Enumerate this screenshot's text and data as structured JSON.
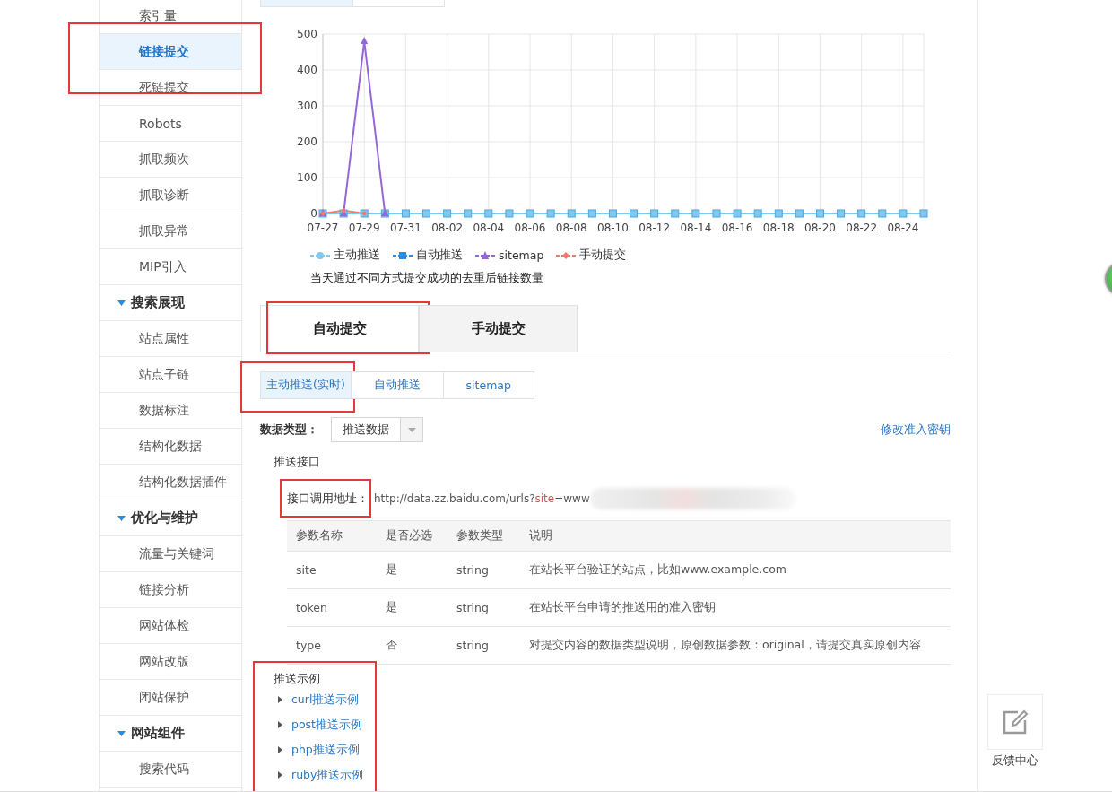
{
  "sidebar": {
    "items": [
      {
        "kind": "item",
        "label": "索引量",
        "selected": false,
        "highlighted": false
      },
      {
        "kind": "item",
        "label": "链接提交",
        "selected": true,
        "highlighted": true
      },
      {
        "kind": "item",
        "label": "死链提交",
        "selected": false,
        "highlighted": false
      },
      {
        "kind": "item",
        "label": "Robots",
        "selected": false,
        "highlighted": false
      },
      {
        "kind": "item",
        "label": "抓取频次",
        "selected": false,
        "highlighted": false
      },
      {
        "kind": "item",
        "label": "抓取诊断",
        "selected": false,
        "highlighted": false
      },
      {
        "kind": "item",
        "label": "抓取异常",
        "selected": false,
        "highlighted": false
      },
      {
        "kind": "item",
        "label": "MIP引入",
        "selected": false,
        "highlighted": false
      },
      {
        "kind": "section",
        "label": "搜索展现",
        "expanded": true
      },
      {
        "kind": "item",
        "label": "站点属性",
        "selected": false,
        "highlighted": false
      },
      {
        "kind": "item",
        "label": "站点子链",
        "selected": false,
        "highlighted": false
      },
      {
        "kind": "item",
        "label": "数据标注",
        "selected": false,
        "highlighted": false
      },
      {
        "kind": "item",
        "label": "结构化数据",
        "selected": false,
        "highlighted": false
      },
      {
        "kind": "item",
        "label": "结构化数据插件",
        "selected": false,
        "highlighted": false
      },
      {
        "kind": "section",
        "label": "优化与维护",
        "expanded": true
      },
      {
        "kind": "item",
        "label": "流量与关键词",
        "selected": false,
        "highlighted": false
      },
      {
        "kind": "item",
        "label": "链接分析",
        "selected": false,
        "highlighted": false
      },
      {
        "kind": "item",
        "label": "网站体检",
        "selected": false,
        "highlighted": false
      },
      {
        "kind": "item",
        "label": "网站改版",
        "selected": false,
        "highlighted": false
      },
      {
        "kind": "item",
        "label": "闭站保护",
        "selected": false,
        "highlighted": false
      },
      {
        "kind": "section",
        "label": "网站组件",
        "expanded": true
      },
      {
        "kind": "item",
        "label": "搜索代码",
        "selected": false,
        "highlighted": false
      }
    ]
  },
  "chart": {
    "chart_data": {
      "type": "line",
      "categories": [
        "07-27",
        null,
        "07-29",
        null,
        "07-31",
        null,
        "08-02",
        null,
        "08-04",
        null,
        "08-06",
        null,
        "08-08",
        null,
        "08-10",
        null,
        "08-12",
        null,
        "08-14",
        null,
        "08-16",
        null,
        "08-18",
        null,
        "08-20",
        null,
        "08-22",
        null,
        "08-24",
        null
      ],
      "yticks": [
        0,
        100,
        200,
        300,
        400,
        500
      ],
      "ylim": [
        0,
        500
      ],
      "grid": true,
      "series": [
        {
          "name": "主动推送",
          "color": "#7fc8ee",
          "marker": "square",
          "values": [
            0,
            0,
            0,
            0,
            0,
            0,
            0,
            0,
            0,
            0,
            0,
            0,
            0,
            0,
            0,
            0,
            0,
            0,
            0,
            0,
            0,
            0,
            0,
            0,
            0,
            0,
            0,
            0,
            0,
            0
          ]
        },
        {
          "name": "自动推送",
          "color": "#2f8be0",
          "values": [
            null,
            null,
            null,
            null,
            null,
            null,
            null,
            null,
            null,
            null,
            null,
            null,
            null,
            null,
            null,
            null,
            null,
            null,
            null,
            null,
            null,
            null,
            null,
            null,
            null,
            null,
            null,
            null,
            null,
            null
          ]
        },
        {
          "name": "sitemap",
          "color": "#9466d8",
          "marker": "triangle",
          "values": [
            0,
            0,
            480,
            0,
            null,
            null,
            null,
            null,
            null,
            null,
            null,
            null,
            null,
            null,
            null,
            null,
            null,
            null,
            null,
            null,
            null,
            null,
            null,
            null,
            null,
            null,
            null,
            null,
            null,
            null
          ]
        },
        {
          "name": "手动提交",
          "color": "#f07a6a",
          "marker": "diamond",
          "values": [
            0,
            8,
            0,
            null,
            null,
            null,
            null,
            null,
            null,
            null,
            null,
            null,
            null,
            null,
            null,
            null,
            null,
            null,
            null,
            null,
            null,
            null,
            null,
            null,
            null,
            null,
            null,
            null,
            null,
            null
          ]
        }
      ]
    },
    "caption": "当天通过不同方式提交成功的去重后链接数量"
  },
  "tabs": [
    {
      "label": "自动提交",
      "selected": true,
      "highlighted": true
    },
    {
      "label": "手动提交",
      "selected": false,
      "highlighted": false
    }
  ],
  "subtabs": [
    {
      "label": "主动推送(实时)",
      "selected": true,
      "highlighted": true
    },
    {
      "label": "自动推送",
      "selected": false,
      "highlighted": false
    },
    {
      "label": "sitemap",
      "selected": false,
      "highlighted": false
    }
  ],
  "data_type": {
    "label": "数据类型：",
    "value": "推送数据"
  },
  "change_key_link": "修改准入密钥",
  "interface": {
    "title": "推送接口",
    "address_label": "接口调用地址：",
    "address_highlighted": true,
    "url_prefix": "http://data.zz.baidu.com/urls?",
    "url_param": "site",
    "url_suffix": "=www"
  },
  "table": {
    "columns": [
      "参数名称",
      "是否必选",
      "参数类型",
      "说明"
    ],
    "rows": [
      [
        "site",
        "是",
        "string",
        "在站长平台验证的站点，比如www.example.com"
      ],
      [
        "token",
        "是",
        "string",
        "在站长平台申请的推送用的准入密钥"
      ],
      [
        "type",
        "否",
        "string",
        "对提交内容的数据类型说明，原创数据参数：original，请提交真实原创内容"
      ]
    ]
  },
  "examples": {
    "title": "推送示例",
    "highlighted": true,
    "items": [
      {
        "label": "curl推送示例",
        "expanded": false
      },
      {
        "label": "post推送示例",
        "expanded": false
      },
      {
        "label": "php推送示例",
        "expanded": false
      },
      {
        "label": "ruby推送示例",
        "expanded": false
      }
    ]
  },
  "feedback": {
    "label": "反馈中心"
  }
}
